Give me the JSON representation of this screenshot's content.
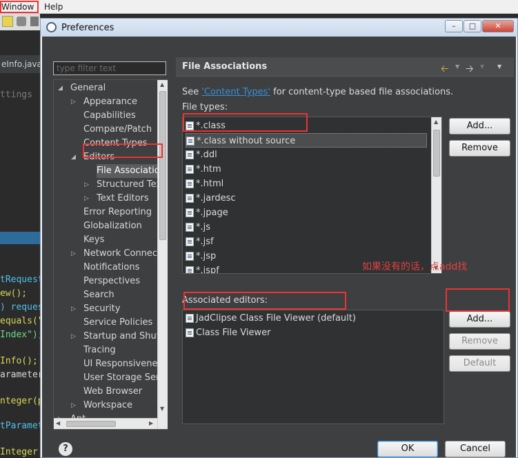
{
  "menubar": {
    "window_label": "Window",
    "help_label": "Help"
  },
  "editor": {
    "tab_label": "eInfo.java",
    "code_lines": [
      {
        "text": "ttings",
        "color": "#7a7a7a"
      },
      {
        "text": "tRequest",
        "color": "#4fc1e9"
      },
      {
        "text": "ew();",
        "color": "#d8d85a"
      },
      {
        "text": ") reques",
        "color": "#4fc1e9"
      },
      {
        "text": "equals(\"",
        "color": "#d8d85a"
      },
      {
        "text": "Index\");",
        "color": "#6fdc8c"
      },
      {
        "text": "Info();",
        "color": "#d8d85a"
      },
      {
        "text": "arameter",
        "color": "#d8d8d8"
      },
      {
        "text": "nteger(p",
        "color": "#d8d85a"
      },
      {
        "text": "tParamet",
        "color": "#4fc1e9"
      },
      {
        "text": " Integer",
        "color": "#d8d85a"
      }
    ]
  },
  "dialog": {
    "title": "Preferences",
    "filter_placeholder": "type filter text",
    "tree": [
      {
        "label": "General",
        "level": 0,
        "arrow": "down"
      },
      {
        "label": "Appearance",
        "level": 1,
        "arrow": "right"
      },
      {
        "label": "Capabilities",
        "level": 1,
        "arrow": ""
      },
      {
        "label": "Compare/Patch",
        "level": 1,
        "arrow": ""
      },
      {
        "label": "Content Types",
        "level": 1,
        "arrow": ""
      },
      {
        "label": "Editors",
        "level": 1,
        "arrow": "down"
      },
      {
        "label": "File Associations",
        "level": 2,
        "arrow": "",
        "selected": true
      },
      {
        "label": "Structured Text",
        "level": 2,
        "arrow": "right"
      },
      {
        "label": "Text Editors",
        "level": 2,
        "arrow": "right"
      },
      {
        "label": "Error Reporting",
        "level": 1,
        "arrow": ""
      },
      {
        "label": "Globalization",
        "level": 1,
        "arrow": ""
      },
      {
        "label": "Keys",
        "level": 1,
        "arrow": ""
      },
      {
        "label": "Network Connections",
        "level": 1,
        "arrow": "right"
      },
      {
        "label": "Notifications",
        "level": 1,
        "arrow": ""
      },
      {
        "label": "Perspectives",
        "level": 1,
        "arrow": ""
      },
      {
        "label": "Search",
        "level": 1,
        "arrow": ""
      },
      {
        "label": "Security",
        "level": 1,
        "arrow": "right"
      },
      {
        "label": "Service Policies",
        "level": 1,
        "arrow": ""
      },
      {
        "label": "Startup and Shutdown",
        "level": 1,
        "arrow": "right"
      },
      {
        "label": "Tracing",
        "level": 1,
        "arrow": ""
      },
      {
        "label": "UI Responsiveness",
        "level": 1,
        "arrow": ""
      },
      {
        "label": "User Storage Service",
        "level": 1,
        "arrow": ""
      },
      {
        "label": "Web Browser",
        "level": 1,
        "arrow": ""
      },
      {
        "label": "Workspace",
        "level": 1,
        "arrow": "right"
      },
      {
        "label": "Ant",
        "level": 0,
        "arrow": "right"
      }
    ],
    "page_title": "File Associations",
    "see_prefix": "See ",
    "see_link": "'Content Types'",
    "see_suffix": " for content-type based file associations.",
    "file_types_label": "File types:",
    "file_types": [
      "*.class",
      "*.class without source",
      "*.ddl",
      "*.htm",
      "*.html",
      "*.jardesc",
      "*.jpage",
      "*.js",
      "*.jsf",
      "*.jsp",
      "*.jspf"
    ],
    "selected_file_type_index": 1,
    "add_label": "Add...",
    "remove_label": "Remove",
    "note_text": "如果没有的话，点add找",
    "editors_label": "Associated editors:",
    "editors": [
      "JadClipse Class File Viewer (default)",
      "Class File Viewer"
    ],
    "add2_label": "Add...",
    "remove2_label": "Remove",
    "default_label": "Default",
    "ok_label": "OK",
    "cancel_label": "Cancel",
    "help_icon": "?"
  }
}
